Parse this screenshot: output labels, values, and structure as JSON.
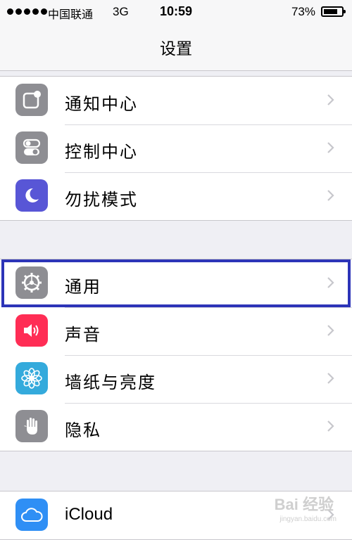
{
  "status_bar": {
    "carrier": "中国联通",
    "network": "3G",
    "time": "10:59",
    "battery": "73%",
    "battery_level": 0.73
  },
  "nav": {
    "title": "设置"
  },
  "groups": [
    [
      {
        "label": "通知中心",
        "icon": "notification-center-icon",
        "color": "#8e8e93"
      },
      {
        "label": "控制中心",
        "icon": "control-center-icon",
        "color": "#8e8e93"
      },
      {
        "label": "勿扰模式",
        "icon": "moon-icon",
        "color": "#5856d6"
      }
    ],
    [
      {
        "label": "通用",
        "icon": "gear-icon",
        "color": "#8e8e93"
      },
      {
        "label": "声音",
        "icon": "speaker-icon",
        "color": "#ff2d55"
      },
      {
        "label": "墙纸与亮度",
        "icon": "flower-icon",
        "color": "#34aadc"
      },
      {
        "label": "隐私",
        "icon": "hand-icon",
        "color": "#8e8e93"
      }
    ],
    [
      {
        "label": "iCloud",
        "icon": "cloud-icon",
        "color": "#2f8ff5"
      }
    ]
  ],
  "watermark": {
    "text": "Bai 经验",
    "sub": "jingyan.baidu.com"
  }
}
